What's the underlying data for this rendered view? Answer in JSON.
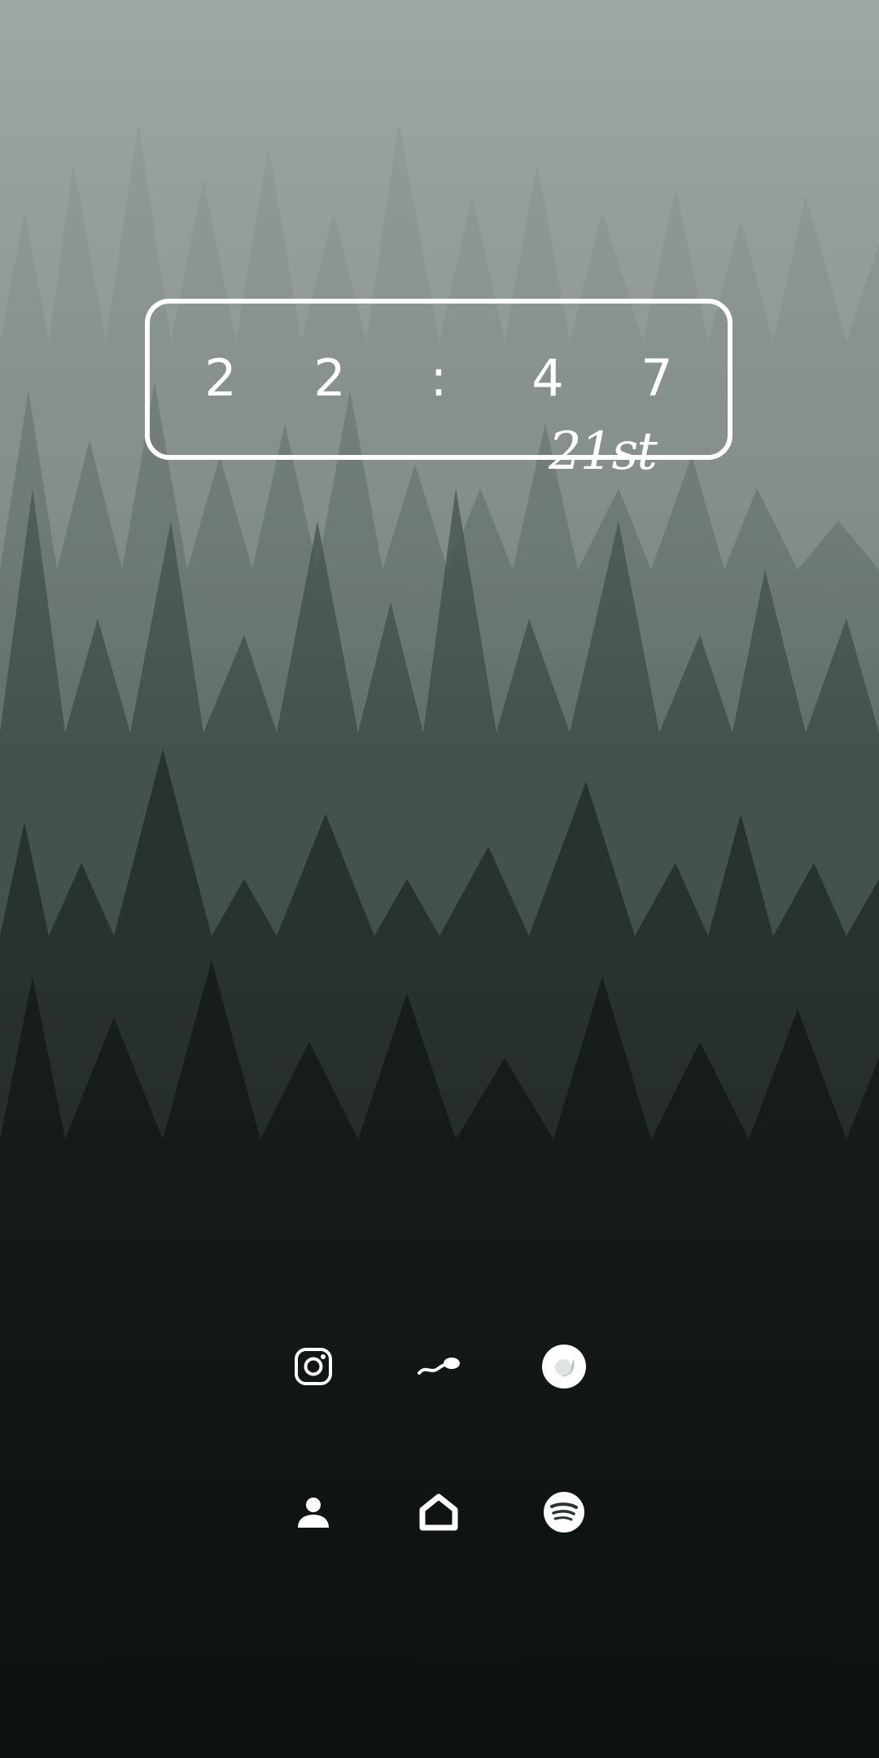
{
  "clock": {
    "hour_tens": "2",
    "hour_ones": "2",
    "separator": ":",
    "minute_tens": "4",
    "minute_ones": "7",
    "date": "21st"
  },
  "dock": {
    "row1": [
      {
        "icon": "instagram-icon"
      },
      {
        "icon": "sperm-swim-icon"
      },
      {
        "icon": "circle-app-icon"
      }
    ],
    "row2": [
      {
        "icon": "contacts-person-icon"
      },
      {
        "icon": "home-icon"
      },
      {
        "icon": "spotify-icon"
      }
    ]
  },
  "colors": {
    "icon": "#ffffff",
    "sky": "#9ea7a5",
    "forest_dark": "#141b19"
  }
}
